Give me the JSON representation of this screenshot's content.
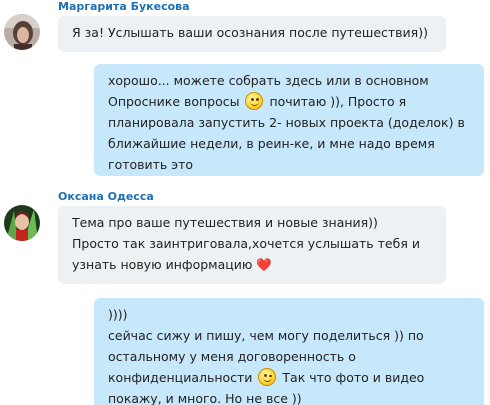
{
  "messages": [
    {
      "sender": "Маргарита Букесова",
      "lines": [
        "Я за! Услышать ваши осознания после путешествия))"
      ]
    },
    {
      "lines": [
        [
          "хорошо... можете собрать здесь или в основном"
        ],
        [
          "Опроснике вопросы ",
          " почитаю )),    Просто я"
        ],
        [
          "планировала запустить 2- новых проекта (доделок) в"
        ],
        [
          "ближайшие недели, в реин-ке, и мне надо время"
        ],
        [
          "готовить это"
        ]
      ],
      "emoji": "smile-emoji"
    },
    {
      "sender": "Оксана Одесса",
      "lines": [
        "Тема про ваше путешествия и новые знания))",
        "Просто так заинтриговала,хочется услышать тебя и",
        "узнать новую информацию ❤️"
      ]
    },
    {
      "lines": [
        "))))",
        "сейчас сижу и пишу, чем могу поделиться )) по",
        "остальному у меня договоренность о",
        [
          "конфиденциальности ",
          "  Так что фото и видео"
        ],
        "покажу, и много. Но не все ))"
      ],
      "emoji": "wink-emoji"
    }
  ]
}
